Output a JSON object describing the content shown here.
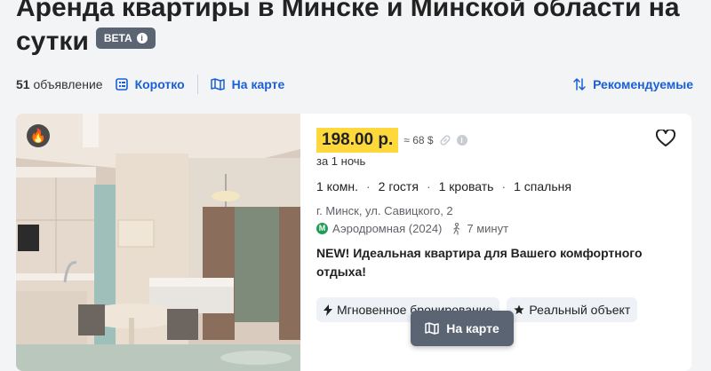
{
  "page": {
    "title": "Аренда квартиры в Минске и Минской области на сутки",
    "beta_label": "BETA",
    "beta_info_glyph": "i"
  },
  "toolbar": {
    "count_number": "51",
    "count_label": "объявление",
    "short_label": "Коротко",
    "map_label": "На карте",
    "sort_label": "Рекомендуемые"
  },
  "listing": {
    "badge_icon": "fire-icon",
    "price": "198.00 р.",
    "price_usd": "≈ 68 $",
    "price_info_glyph": "i",
    "per": "за 1 ночь",
    "params": [
      "1 комн.",
      "2 гостя",
      "1 кровать",
      "1 спальня"
    ],
    "param_separator": "·",
    "address": "г. Минск, ул. Савицкого, 2",
    "metro_glyph": "М",
    "metro": "Аэродромная (2024)",
    "walk_time": "7 минут",
    "description": "NEW! Идеальная квартира для Вашего комфортного отдыха!",
    "chips": [
      "Мгновенное бронирование",
      "Реальный объект"
    ]
  },
  "floating": {
    "map_button_label": "На карте"
  },
  "colors": {
    "link": "#1a5fd6",
    "price_highlight": "#ffd83b",
    "beta_bg": "#5b6472",
    "metro": "#1f9d55"
  }
}
